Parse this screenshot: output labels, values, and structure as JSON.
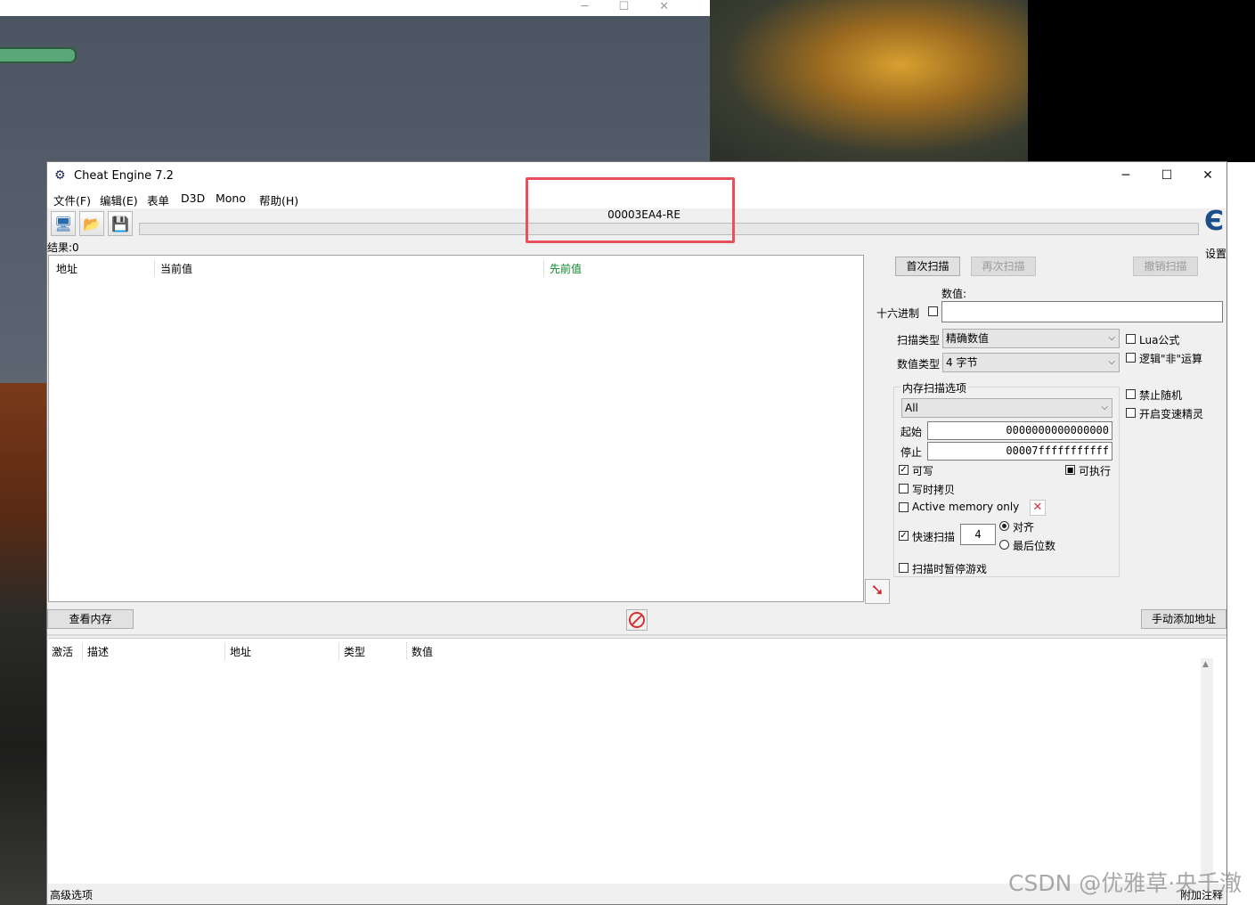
{
  "window": {
    "title": "Cheat Engine 7.2",
    "minimize": "─",
    "maximize": "☐",
    "close": "✕"
  },
  "menu": [
    "文件(F)",
    "编辑(E)",
    "表单",
    "D3D",
    "Mono",
    "帮助(H)"
  ],
  "process_label": "00003EA4-RE",
  "settings_label": "设置",
  "results": {
    "count_label": "结果:0"
  },
  "result_columns": [
    "地址",
    "当前值",
    "先前值"
  ],
  "scan_buttons": {
    "first_scan": "首次扫描",
    "next_scan": "再次扫描",
    "undo_scan": "撤销扫描"
  },
  "value": {
    "label": "数值:",
    "hex_label": "十六进制",
    "input": ""
  },
  "scan_type": {
    "label": "扫描类型",
    "selected": "精确数值"
  },
  "value_type": {
    "label": "数值类型",
    "selected": "4 字节"
  },
  "options_right": {
    "lua": "Lua公式",
    "not_op": "逻辑\"非\"运算",
    "no_random": "禁止随机",
    "speedhack": "开启变速精灵"
  },
  "memory_options": {
    "title": "内存扫描选项",
    "region": "All",
    "start_label": "起始",
    "start_value": "0000000000000000",
    "stop_label": "停止",
    "stop_value": "00007fffffffffff",
    "writable": "可写",
    "executable": "可执行",
    "copy_on_write": "写时拷贝",
    "active_memory": "Active memory only",
    "fast_scan": "快速扫描",
    "fast_scan_value": "4",
    "align": "对齐",
    "last_digits": "最后位数",
    "pause_game": "扫描时暂停游戏"
  },
  "buttons": {
    "view_memory": "查看内存",
    "add_address": "手动添加地址"
  },
  "address_columns": [
    "激活",
    "描述",
    "地址",
    "类型",
    "数值"
  ],
  "status": {
    "left": "高级选项",
    "right": "附加注释"
  },
  "background": {
    "watermark": "CSDN @优雅草·央千澈"
  }
}
